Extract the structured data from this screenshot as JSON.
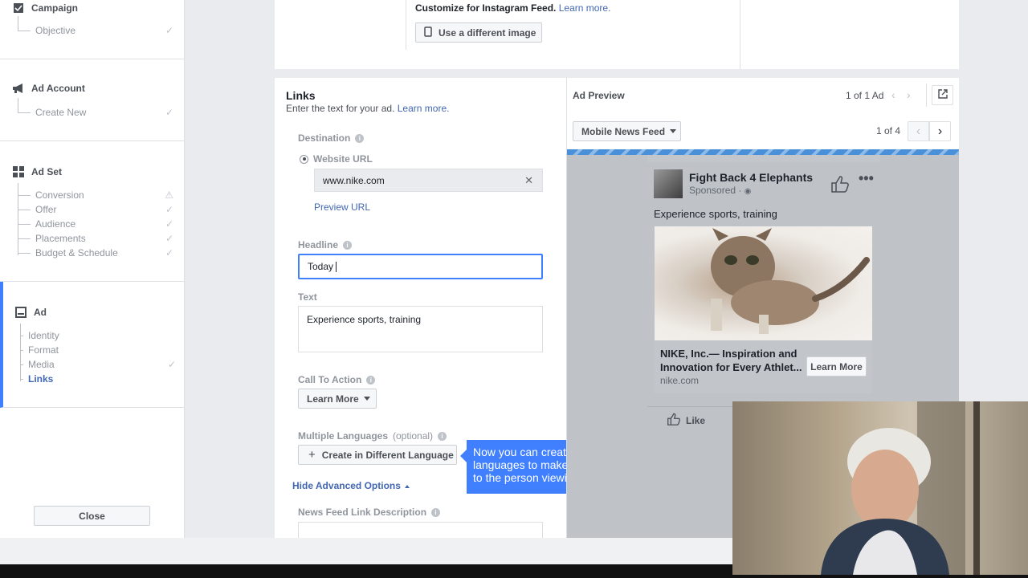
{
  "sidebar": {
    "campaign": {
      "title": "Campaign",
      "items": [
        {
          "label": "Objective",
          "status": "✓"
        }
      ]
    },
    "ad_account": {
      "title": "Ad Account",
      "items": [
        {
          "label": "Create New",
          "status": "✓"
        }
      ]
    },
    "ad_set": {
      "title": "Ad Set",
      "items": [
        {
          "label": "Conversion",
          "status": "⚠"
        },
        {
          "label": "Offer",
          "status": "✓"
        },
        {
          "label": "Audience",
          "status": "✓"
        },
        {
          "label": "Placements",
          "status": "✓"
        },
        {
          "label": "Budget & Schedule",
          "status": "✓"
        }
      ]
    },
    "ad": {
      "title": "Ad",
      "items": [
        {
          "label": "Identity",
          "status": ""
        },
        {
          "label": "Format",
          "status": ""
        },
        {
          "label": "Media",
          "status": "✓"
        },
        {
          "label": "Links",
          "status": ""
        }
      ]
    },
    "close_label": "Close"
  },
  "top": {
    "instagram_text": "Customize for Instagram Feed.",
    "learn_more": "Learn more.",
    "use_image_label": "Use a different image"
  },
  "links": {
    "title": "Links",
    "subtitle": "Enter the text for your ad.",
    "learn_more": "Learn more.",
    "destination_label": "Destination",
    "website_url_label": "Website URL",
    "website_url_value": "www.nike.com",
    "preview_url": "Preview URL",
    "headline_label": "Headline",
    "headline_value": "Today",
    "text_label": "Text",
    "text_value": "Experience sports, training",
    "cta_label": "Call To Action",
    "cta_value": "Learn More",
    "languages_label": "Multiple Languages",
    "languages_optional": "(optional)",
    "create_language_label": "Create in Different Language",
    "hide_advanced": "Hide Advanced Options",
    "news_feed_desc_label": "News Feed Link Description"
  },
  "tooltip": {
    "text": "Now you can create an ad in different languages to make it more relevant to the person viewing it."
  },
  "preview": {
    "title": "Ad Preview",
    "ad_count": "1 of 1 Ad",
    "placement": "Mobile News Feed",
    "page_count": "1 of 4",
    "page_name": "Fight Back 4 Elephants",
    "sponsored": "Sponsored ·",
    "post_text": "Experience sports, training",
    "headline": "NIKE, Inc.— Inspiration and Innovation for Every Athlet...",
    "domain": "nike.com",
    "cta": "Learn More",
    "like": "Like"
  },
  "colors": {
    "accent": "#4267b2",
    "tooltip": "#4080ff",
    "stripe": "#4a90d9"
  }
}
